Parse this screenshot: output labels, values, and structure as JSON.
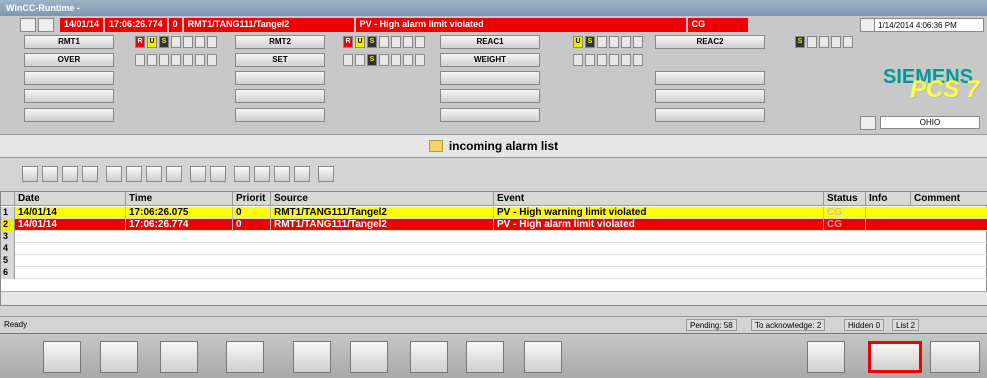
{
  "window": {
    "title": "WinCC-Runtime -"
  },
  "top_alarm": {
    "date": "14/01/14",
    "time": "17:06:26.774",
    "priority": "0",
    "source": "RMT1/TANG111/Tangel2",
    "event": "PV - High alarm limit violated",
    "status": "CG"
  },
  "datetime": "1/14/2014 4:06:36 PM",
  "site": "OHIO",
  "brand": {
    "name": "SIEMENS",
    "product": "PCS 7"
  },
  "areas": [
    {
      "label": "RMT1",
      "r": "R",
      "u": "U",
      "s": "S"
    },
    {
      "label": "RMT2",
      "r": "R",
      "u": "U",
      "s": "S"
    },
    {
      "label": "REAC1",
      "u": "U",
      "s": "S"
    },
    {
      "label": "REAC2",
      "s": "S"
    },
    {
      "label": "OVER"
    },
    {
      "label": "SET",
      "s": "S"
    },
    {
      "label": "WEIGHT"
    }
  ],
  "list_title": "incoming alarm list",
  "columns": [
    "Date",
    "Time",
    "Priorit",
    "Source",
    "Event",
    "Status",
    "Info",
    "Comment"
  ],
  "rows": [
    {
      "n": "1",
      "date": "14/01/14",
      "time": "17:06:26.075",
      "priority": "0",
      "source": "RMT1/TANG111/Tangel2",
      "event": "PV - High warning limit violated",
      "status": "CG",
      "color": "yellow"
    },
    {
      "n": "2",
      "date": "14/01/14",
      "time": "17:06:26.774",
      "priority": "0",
      "source": "RMT1/TANG111/Tangel2",
      "event": "PV - High alarm limit violated",
      "status": "CG",
      "color": "red"
    },
    {
      "n": "3"
    },
    {
      "n": "4"
    },
    {
      "n": "5"
    },
    {
      "n": "6"
    }
  ],
  "status_bar": {
    "ready": "Ready",
    "pending": "Pending: 58",
    "to_ack": "To acknowledge: 2",
    "hidden": "Hidden 0",
    "list": "List 2"
  },
  "colors": {
    "alarm_red": "#e00000",
    "warning_yellow": "#ffff00",
    "siemens_teal": "#009999"
  }
}
